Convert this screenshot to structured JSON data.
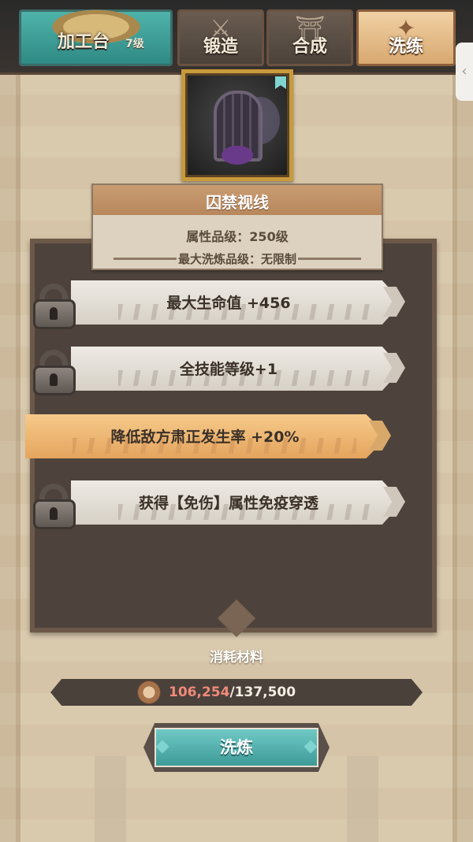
{
  "tabs": {
    "workbench": {
      "label": "加工台",
      "level": "7级"
    },
    "forge": {
      "label": "锻造"
    },
    "synthesize": {
      "label": "合成"
    },
    "refine": {
      "label": "洗练"
    }
  },
  "side_handle": {
    "glyph": "‹"
  },
  "item": {
    "name": "囚禁视线",
    "attribute_level": "属性品级：250级",
    "max_refine_level": "最大洗炼品级：无限制"
  },
  "stats": [
    {
      "text": "最大生命值 +456",
      "locked": true
    },
    {
      "text": "全技能等级+1",
      "locked": true
    },
    {
      "text": "降低敌方肃正发生率 +20%",
      "locked": false
    },
    {
      "text": "获得【免伤】属性免疫穿透",
      "locked": true
    }
  ],
  "materials": {
    "label": "消耗材料",
    "current": "106,254",
    "separator": "/",
    "total": "137,500"
  },
  "action": {
    "label": "洗炼"
  },
  "colors": {
    "active_tab": "#e8bb86",
    "workbench_tab": "#3f9f98",
    "active_stat": "#f0b872",
    "button": "#4fb3ae",
    "material_current": "#f08a78"
  }
}
